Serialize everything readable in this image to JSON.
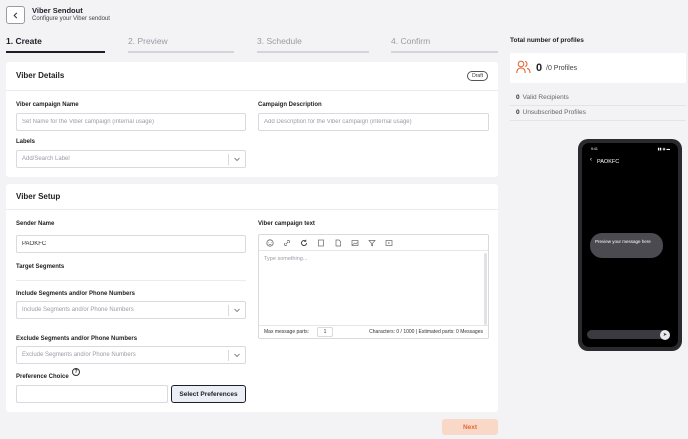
{
  "header": {
    "title": "Viber Sendout",
    "subtitle": "Configure your Viber sendout"
  },
  "steps": [
    {
      "label": "1. Create",
      "active": true
    },
    {
      "label": "2. Preview",
      "active": false
    },
    {
      "label": "3. Schedule",
      "active": false
    },
    {
      "label": "4. Confirm",
      "active": false
    }
  ],
  "viber_details": {
    "title": "Viber Details",
    "badge": "Draft",
    "campaign_name_label": "Viber campaign Name",
    "campaign_name_placeholder": "Set Name for the Viber campaign (internal usage)",
    "description_label": "Campaign Description",
    "description_placeholder": "Add Description for the Viber campaign (internal usage)",
    "labels_label": "Labels",
    "labels_placeholder": "Add/Search Label"
  },
  "viber_setup": {
    "title": "Viber Setup",
    "sender_name_label": "Sender Name",
    "sender_name_value": "PAOKFC",
    "target_segments_label": "Target Segments",
    "include_label": "Include Segments and/or Phone Numbers",
    "include_placeholder": "Include Segments and/or Phone Numbers",
    "exclude_label": "Exclude Segments and/or Phone Numbers",
    "exclude_placeholder": "Exclude Segments and/or Phone Numbers",
    "preference_label": "Preference Choice",
    "help_glyph": "?",
    "select_preferences_label": "Select Preferences",
    "campaign_text_label": "Viber campaign text",
    "editor_placeholder": "Type something...",
    "max_parts_label": "Max message parts:",
    "max_parts_value": "1",
    "characters_info": "Characters: 0 / 1000 | Estimated parts: 0 Messages"
  },
  "actions": {
    "next_label": "Next"
  },
  "profiles": {
    "title": "Total number of profiles",
    "count": "0",
    "total": "/0 Profiles",
    "valid_count": "0",
    "valid_label": "Valid Recipients",
    "unsub_count": "0",
    "unsub_label": "Unsubscribed Profiles"
  },
  "phone_preview": {
    "time": "9:41",
    "status_icons": "▮▮ ◉ ▬",
    "back_glyph": "‹",
    "sender": "PAOKFC",
    "bubble_text": "Preview your message here",
    "send_glyph": "➤"
  },
  "colors": {
    "accent": "#e26a3a",
    "accent_light": "#f9d8c8",
    "profile_icon": "#e26a3a"
  }
}
